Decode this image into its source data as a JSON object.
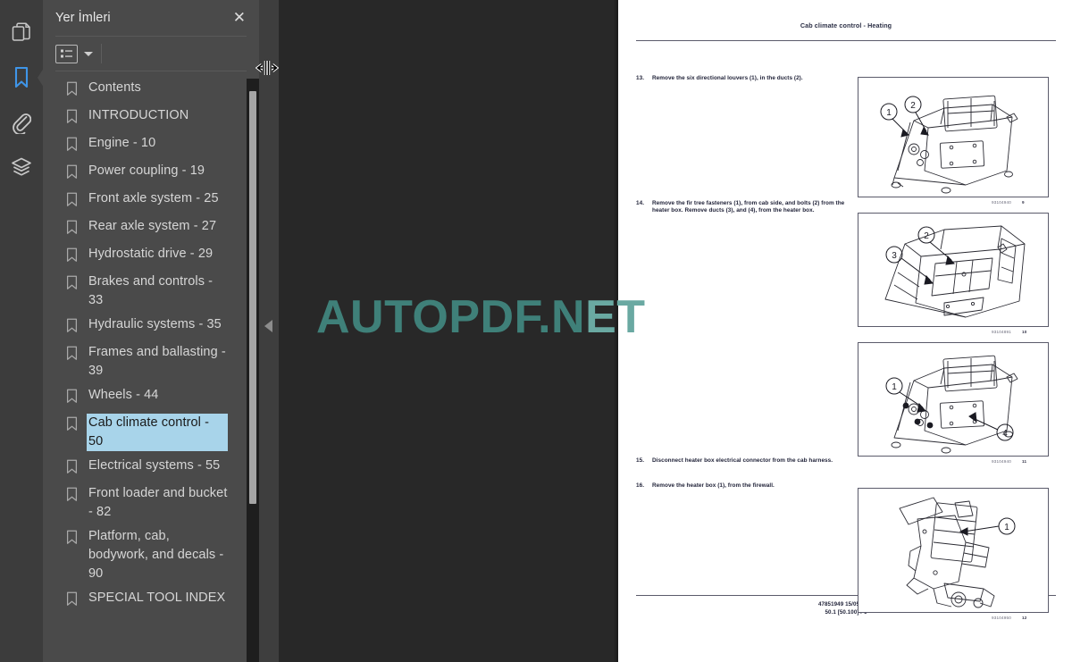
{
  "rail": {
    "items": [
      {
        "icon": "pages-icon",
        "name": "thumbnails",
        "active": false
      },
      {
        "icon": "bookmark-icon",
        "name": "bookmarks",
        "active": true
      },
      {
        "icon": "paperclip-icon",
        "name": "attachments",
        "active": false
      },
      {
        "icon": "layers-icon",
        "name": "layers",
        "active": false
      }
    ]
  },
  "panel": {
    "title": "Yer İmleri",
    "close_label": "✕",
    "toolbar": {
      "list_options_icon": "list-options-icon",
      "dropdown_icon": "chevron-down-icon"
    },
    "bookmarks": [
      {
        "label": "Contents",
        "selected": false
      },
      {
        "label": "INTRODUCTION",
        "selected": false
      },
      {
        "label": "Engine - 10",
        "selected": false
      },
      {
        "label": "Power coupling - 19",
        "selected": false
      },
      {
        "label": "Front axle system - 25",
        "selected": false
      },
      {
        "label": "Rear axle system - 27",
        "selected": false
      },
      {
        "label": "Hydrostatic drive - 29",
        "selected": false
      },
      {
        "label": "Brakes and controls - 33",
        "selected": false
      },
      {
        "label": "Hydraulic systems - 35",
        "selected": false
      },
      {
        "label": "Frames and ballasting - 39",
        "selected": false
      },
      {
        "label": "Wheels - 44",
        "selected": false
      },
      {
        "label": "Cab climate control - 50",
        "selected": true
      },
      {
        "label": "Electrical systems - 55",
        "selected": false
      },
      {
        "label": "Front loader and bucket - 82",
        "selected": false
      },
      {
        "label": "Platform, cab, bodywork, and decals - 90",
        "selected": false
      },
      {
        "label": "SPECIAL TOOL INDEX",
        "selected": false
      }
    ]
  },
  "viewer": {
    "collapse_icon": "collapse-left-arrow-icon",
    "watermark_dark": "AUTOPDF.N",
    "watermark_light": "ET"
  },
  "document": {
    "header": "Cab climate control - Heating",
    "steps": [
      {
        "num": "13.",
        "text": "Remove the six directional louvers (1), in the ducts (2)."
      },
      {
        "num": "14.",
        "text": "Remove the fir tree fasteners (1), from cab side, and bolts (2) from the heater box. Remove ducts (3), and (4), from the heater box."
      },
      {
        "num": "15.",
        "text": "Disconnect heater box electrical connector from the cab harness."
      },
      {
        "num": "16.",
        "text": "Remove the heater box (1), from the firewall."
      }
    ],
    "figures": [
      {
        "code": "93104940",
        "number": "9",
        "callouts": [
          "1",
          "2"
        ]
      },
      {
        "code": "93104891",
        "number": "10",
        "callouts": [
          "2",
          "3"
        ]
      },
      {
        "code": "93104940",
        "number": "11",
        "callouts": [
          "1",
          "4"
        ]
      },
      {
        "code": "93104950",
        "number": "12",
        "callouts": [
          "1"
        ]
      }
    ],
    "footer_line1": "47851949 15/05/2015",
    "footer_line2": "50.1 [50.100] / 6"
  },
  "colors": {
    "rail_bg": "#3c3c3c",
    "panel_bg": "#4a4a4a",
    "viewer_bg": "#282828",
    "accent_blue": "#3f95e8",
    "selection_blue": "#a8d4ea",
    "watermark_teal": "#3f8079"
  }
}
